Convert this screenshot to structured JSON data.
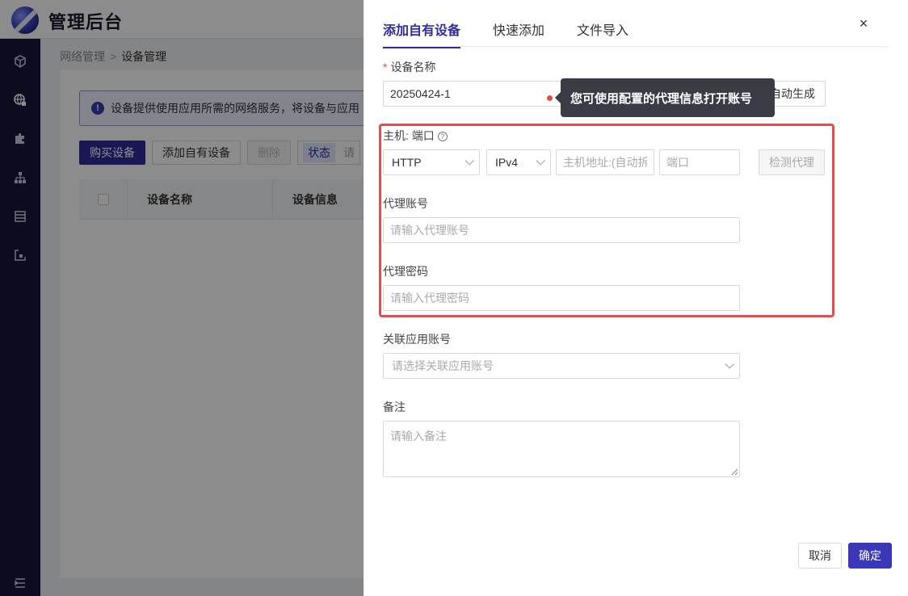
{
  "app": {
    "title": "管理后台"
  },
  "sidebar": {
    "icons": [
      "cube-icon",
      "globe-lock-icon",
      "puzzle-icon",
      "sitemap-icon",
      "list-icon",
      "export-icon",
      "collapse-icon"
    ]
  },
  "breadcrumb": {
    "parent": "网络管理",
    "separator": ">",
    "current": "设备管理"
  },
  "notice": {
    "text": "设备提供使用应用所需的网络服务，将设备与应用"
  },
  "toolbar": {
    "buy_label": "购买设备",
    "add_own_label": "添加自有设备",
    "delete_label": "删除",
    "status_label": "状态",
    "status_placeholder": "请"
  },
  "table": {
    "columns": [
      "设备名称",
      "设备信息"
    ]
  },
  "drawer": {
    "tabs": [
      {
        "label": "添加自有设备",
        "active": true
      },
      {
        "label": "快速添加",
        "active": false
      },
      {
        "label": "文件导入",
        "active": false
      }
    ],
    "close_label": "×",
    "device_name": {
      "required_mark": "*",
      "label": "设备名称",
      "value": "20250424-1",
      "auto_button": "自动生成"
    },
    "tooltip": "您可使用配置的代理信息打开账号",
    "host_port": {
      "label": "主机: 端口",
      "help": "?",
      "protocol": "HTTP",
      "ip_version": "IPv4",
      "host_placeholder": "主机地址:(自动拆",
      "port_placeholder": "端口",
      "check_button": "检测代理"
    },
    "proxy_account": {
      "label": "代理账号",
      "placeholder": "请输入代理账号"
    },
    "proxy_password": {
      "label": "代理密码",
      "placeholder": "请输入代理密码"
    },
    "linked_account": {
      "label": "关联应用账号",
      "placeholder": "请选择关联应用账号"
    },
    "remark": {
      "label": "备注",
      "placeholder": "请输入备注"
    },
    "footer": {
      "cancel": "取消",
      "confirm": "确定"
    }
  },
  "colors": {
    "accent": "#2f2d9c",
    "highlight": "#e34d4d",
    "tooltip_bg": "#3a3b45"
  }
}
